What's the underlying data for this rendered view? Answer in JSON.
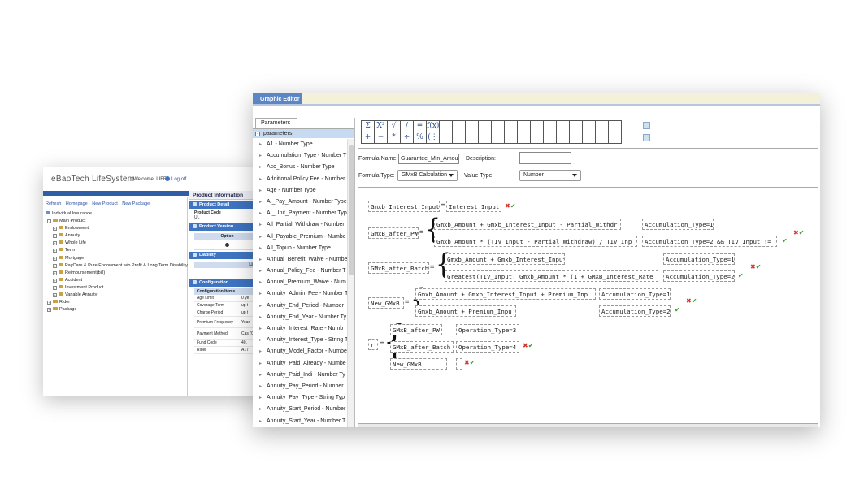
{
  "back_window": {
    "app_title": "eBaoTech LifeSystem",
    "welcome": "Welcome, LIFE",
    "logoff": "Log off",
    "links": [
      "Refresh",
      "Homepage",
      "New Product",
      "New Package"
    ],
    "tree": [
      "Individual Insurance",
      "Main Product",
      "Endowment",
      "Annuity",
      "Whole Life",
      "Term",
      "Mortgage",
      "PayCare & Pure Endowment w/o Profit & Long Term Disability",
      "Reimbursement(bill)",
      "Accident",
      "Investment Product",
      "Variable Annuity",
      "Rider",
      "Package"
    ],
    "panel_title": "Product Information",
    "product_detail": "Product Detail",
    "product_code_label": "Product Code",
    "product_code_value": "UL",
    "product_version": "Product Version",
    "option_header": "Option",
    "liability": "Liability",
    "liability_col": "Liabi",
    "configuration": "Configuration",
    "config_items_header": "Configuration Items",
    "config_rows": [
      {
        "k": "Age Limit",
        "v": "0 ye"
      },
      {
        "k": "Coverage Term",
        "v": "up t"
      },
      {
        "k": "Charge Period",
        "v": "up t"
      },
      {
        "k": "Premium Frequency",
        "v": "Year"
      },
      {
        "k": "Payment Method",
        "v": "Cas (Cel"
      },
      {
        "k": "Fund Code",
        "v": "40."
      },
      {
        "k": "Rider",
        "v": "A17"
      }
    ]
  },
  "front_window": {
    "tab": "Graphic Editor",
    "params_tab": "Parameters",
    "params_root": "parameters",
    "params": [
      "A1 - Number Type",
      "Accumulation_Type - Number T",
      "Acc_Bonus - Number Type",
      "Additional Policy Fee - Number",
      "Age - Number Type",
      "AI_Pay_Amount - Number Type",
      "AI_Unit_Payment - Number Typ",
      "All_Partial_Withdraw - Number",
      "All_Payable_Premium - Numbe",
      "All_Topup - Number Type",
      "Annual_Benefit_Waive - Numbe",
      "Annual_Policy_Fee - Number T",
      "Annual_Premium_Waive - Num",
      "Annuity_Admin_Fee - Number T",
      "Annuity_End_Period - Number",
      "Annuity_End_Year - Number Ty",
      "Annuity_Interest_Rate - Numb",
      "Annuity_Interest_Type - String T",
      "Annuity_Model_Factor - Numbe",
      "Annuity_Paid_Already - Numbe",
      "Annuity_Paid_Indi - Number Ty",
      "Annuity_Pay_Period - Number",
      "Annuity_Pay_Type - String Typ",
      "Annuity_Start_Period - Number",
      "Annuity_Start_Year - Number T"
    ],
    "toolbar_row1": [
      "Σ",
      "X²",
      "√",
      "/",
      "═",
      "f(x)"
    ],
    "toolbar_row2": [
      "+",
      "−",
      "*",
      "÷",
      "%",
      "(⋮"
    ],
    "form": {
      "formula_name_label": "Formula Name:",
      "formula_name_value": "Guarantee_Min_Amou",
      "description_label": "Description:",
      "description_value": "",
      "formula_type_label": "Formula Type:",
      "formula_type_value": "GMxB Calculation",
      "value_type_label": "Value Type:",
      "value_type_value": "Number"
    },
    "formula": {
      "r1_left": "Gmxb_Interest_Input",
      "r1_right": "Interest_Input",
      "r2_left": "GMxB_after_PW",
      "r2_a": "Gmxb_Amount + Gmxb_Interest_Input - Partial_Withdr",
      "r2_a_cond": "Accumulation_Type=1",
      "r2_b": "Gmxb_Amount * (TIV_Input - Partial_Withdraw) / TIV_Inp",
      "r2_b_cond": "Accumulation_Type=2 && TIV_Input !=",
      "r3_left": "GMxB_after_Batch",
      "r3_a": "Gmxb_Amount + Gmxb_Interest_Input",
      "r3_a_cond": "Accumulation_Type=1",
      "r3_b": "Greatest(TIV_Input, Gmxb_Amount * (1 + GMXB_Interest_Rate",
      "r3_b_cond": "Accumulation_Type=2",
      "r4_left": "New_GMxB",
      "r4_a": "Gmxb_Amount + Gmxb_Interest_Input + Premium_Inp",
      "r4_a_cond": "Accumulation_Type=1",
      "r4_b": "Gmxb_Amount + Premium_Inpu",
      "r4_b_cond": "Accumulation_Type=2",
      "r5_left": "r",
      "r5_a": "GMxB_after_PW",
      "r5_a_cond": "Operation_Type=3",
      "r5_b": "GMxB_after_Batch",
      "r5_b_cond": "Operation_Type=4",
      "r5_c": "New_GMxB",
      "equals": "=",
      "x_mark": "✖",
      "check_mark": "✔"
    }
  }
}
